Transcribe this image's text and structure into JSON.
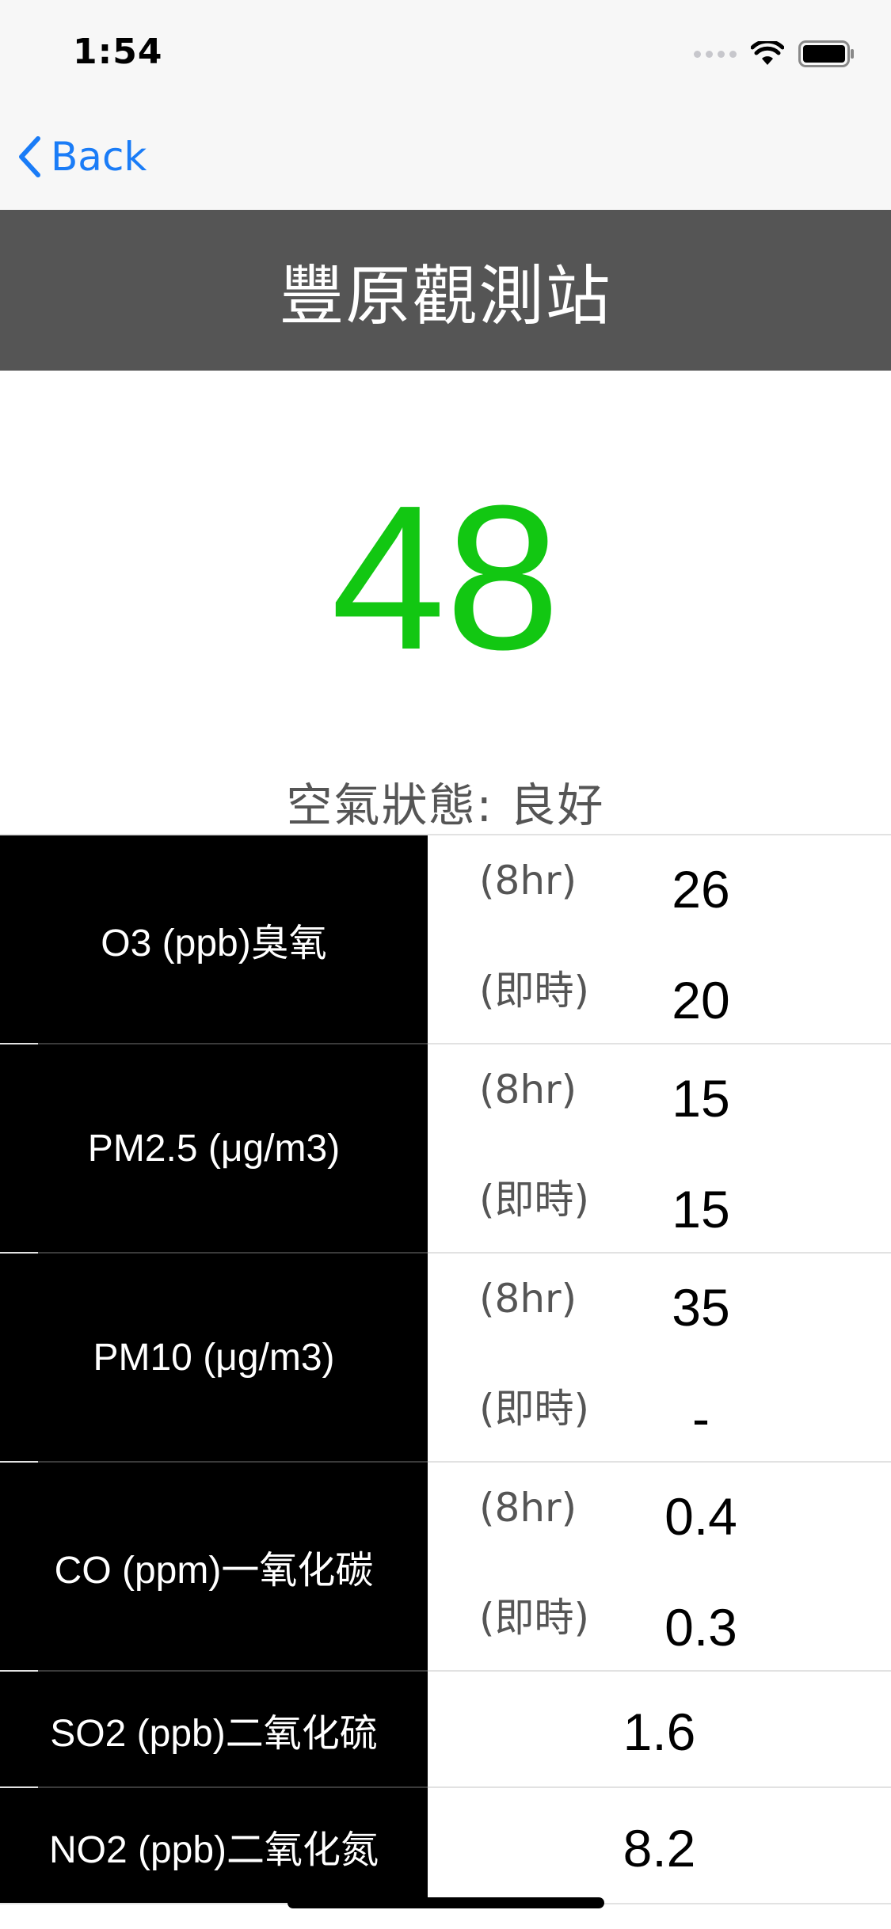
{
  "status_bar": {
    "time": "1:54"
  },
  "nav": {
    "back_label": "Back"
  },
  "station": {
    "title": "豐原觀測站"
  },
  "aqi": {
    "value": "48",
    "color": "#12c712",
    "status_text": "空氣狀態:  良好"
  },
  "pollutants": [
    {
      "name": "O3 (ppb)臭氧",
      "period_8hr": "(8hr)",
      "value_8hr": "26",
      "period_now": "(即時)",
      "value_now": "20"
    },
    {
      "name": "PM2.5 (μg/m3)",
      "period_8hr": "(8hr)",
      "value_8hr": "15",
      "period_now": "(即時)",
      "value_now": "15"
    },
    {
      "name": "PM10 (μg/m3)",
      "period_8hr": "(8hr)",
      "value_8hr": "35",
      "period_now": "(即時)",
      "value_now": "-"
    },
    {
      "name": "CO (ppm)一氧化碳",
      "period_8hr": "(8hr)",
      "value_8hr": "0.4",
      "period_now": "(即時)",
      "value_now": "0.3"
    },
    {
      "name": "SO2 (ppb)二氧化硫",
      "value": "1.6"
    },
    {
      "name": "NO2 (ppb)二氧化氮",
      "value": "8.2"
    }
  ]
}
